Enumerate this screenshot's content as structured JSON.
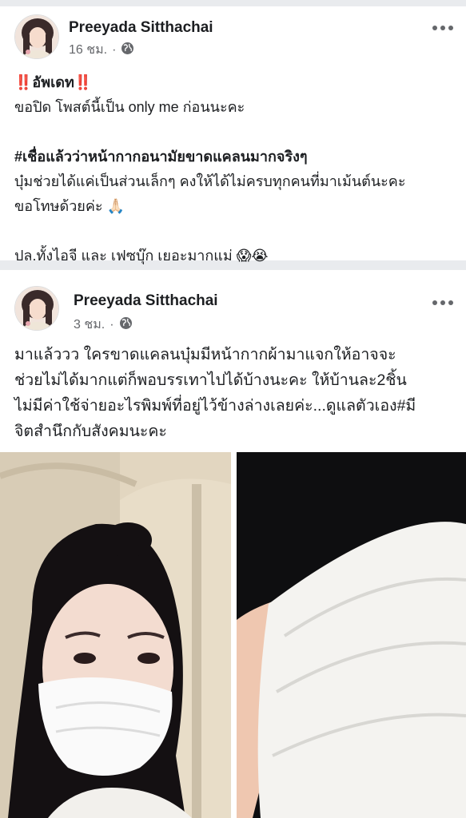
{
  "posts": [
    {
      "author": "Preeyada Sitthachai",
      "time": "16 ชม.",
      "lines": [
        {
          "prefix": "‼️",
          "text": "อัพเดท",
          "suffix": "‼️",
          "style": "normal"
        },
        {
          "text": "ขอปิด โพสต์นี้เป็น only me ก่อนนะคะ",
          "style": "normal"
        },
        {
          "text": "",
          "style": "gap"
        },
        {
          "text": "#เชื่อแล้วว่าหน้ากากอนามัยขาดแคลนมากจริงๆ",
          "style": "bold"
        },
        {
          "text": "บุ๋มช่วยได้แค่เป็นส่วนเล็กๆ คงให้ได้ไม่ครบทุกคนที่มาเม้นต์นะคะ",
          "style": "normal"
        },
        {
          "text": "ขอโทษด้วยค่ะ 🙏🏻",
          "style": "normal"
        },
        {
          "text": "",
          "style": "gap"
        },
        {
          "text": "ปล.ทั้งไอจี และ เฟซบุ๊ก เยอะมากแม่ 😱😭",
          "style": "normal"
        }
      ]
    },
    {
      "author": "Preeyada Sitthachai",
      "time": "3 ชม.",
      "lines": [
        {
          "text": "มาแล้ววว ใครขาดแคลนบุ๋มมีหน้ากากผ้ามาแจกให้อาจจะ",
          "style": "normal"
        },
        {
          "text": "ช่วยไม่ได้มากแต่ก็พอบรรเทาไปได้บ้างนะคะ ให้บ้านละ2ชิ้น",
          "style": "normal"
        },
        {
          "text": "ไม่มีค่าใช้จ่ายอะไรพิมพ์ที่อยู่ไว้ข้างล่างเลยค่ะ...ดูแลตัวเอง#มี",
          "style": "normal"
        },
        {
          "text": "จิตสำนึกกับสังคมนะคะ",
          "style": "normal"
        }
      ]
    }
  ],
  "icons": {
    "privacy": "globe-icon",
    "more": "more-options-icon"
  },
  "colors": {
    "name": "#1c1e21",
    "meta": "#65676b",
    "feed_bg": "#e9ebee"
  }
}
